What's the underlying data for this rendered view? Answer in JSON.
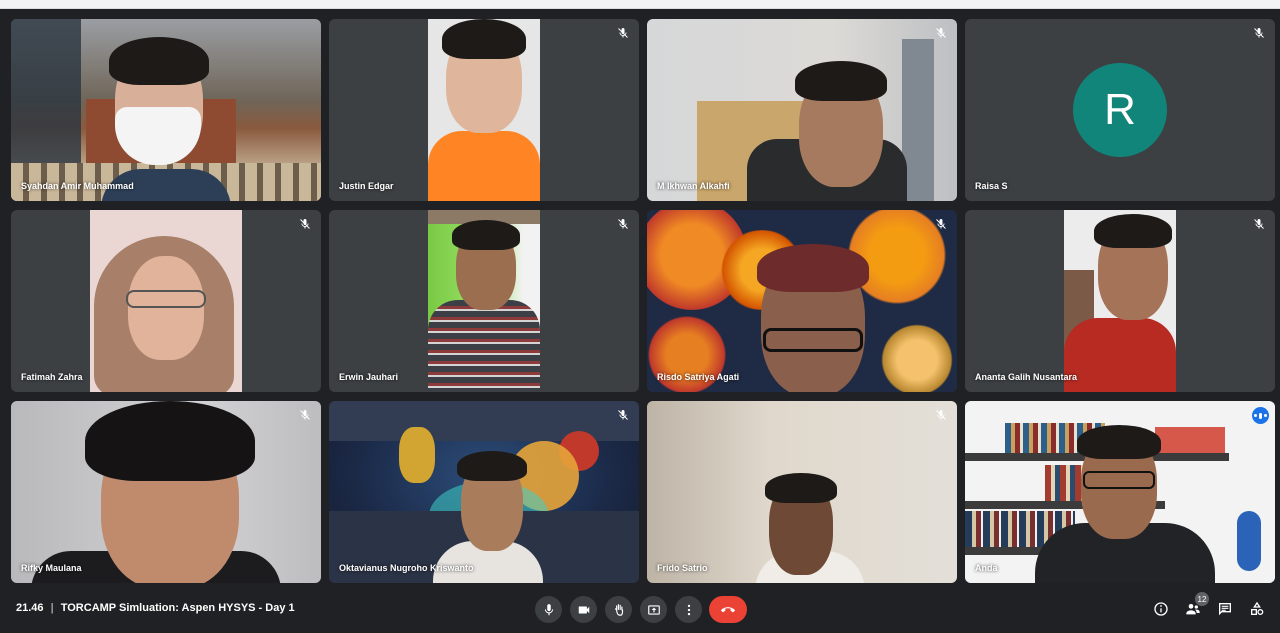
{
  "meeting": {
    "time": "21.46",
    "separator": "|",
    "title": "TORCAMP Simluation: Aspen HYSYS - Day 1"
  },
  "participants": [
    {
      "name": "Syahdan Amir Muhammad",
      "muted": false
    },
    {
      "name": "Justin Edgar",
      "muted": true
    },
    {
      "name": "M Ikhwan Alkahfi",
      "muted": true
    },
    {
      "name": "Raisa S",
      "muted": true,
      "avatar_letter": "R",
      "avatar_color": "#12857a"
    },
    {
      "name": "Fatimah Zahra",
      "muted": true
    },
    {
      "name": "Erwin Jauhari",
      "muted": true
    },
    {
      "name": "Risdo Satriya Agati",
      "muted": true
    },
    {
      "name": "Ananta Galih Nusantara",
      "muted": true
    },
    {
      "name": "Rifky Maulana",
      "muted": true
    },
    {
      "name": "Oktavianus Nugroho Kriswanto",
      "muted": true
    },
    {
      "name": "Frido Satrio",
      "muted": true
    },
    {
      "name": "Anda",
      "muted": false,
      "speaking": true
    }
  ],
  "controls": {
    "microphone": "mic-icon",
    "camera": "camera-icon",
    "raise_hand": "hand-icon",
    "present": "present-icon",
    "more": "more-vert-icon",
    "leave": "end-call-icon"
  },
  "side_controls": {
    "info": "info-icon",
    "people": "people-icon",
    "people_count": "12",
    "chat": "chat-icon",
    "activities": "activities-icon"
  },
  "colors": {
    "background": "#202124",
    "tile": "#3c4043",
    "end_call": "#ea4335",
    "active_speaker": "#1a73e8",
    "avatar": "#12857a"
  }
}
